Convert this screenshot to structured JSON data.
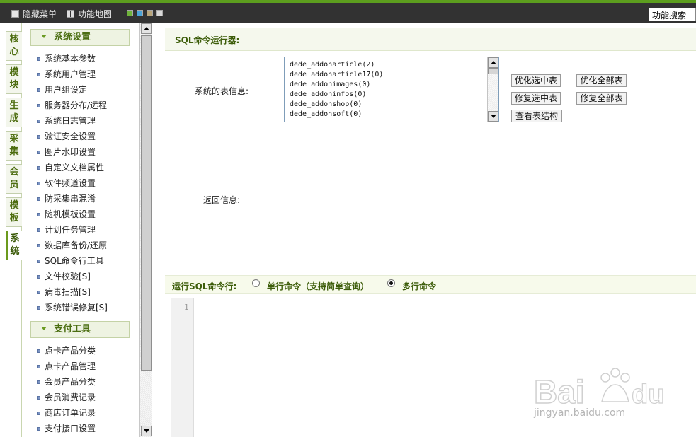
{
  "topbar": {
    "hide_menu": "隐藏菜单",
    "site_map": "功能地图",
    "search": "功能搜索",
    "skins": [
      "#6fb33a",
      "#4aa3d8",
      "#b9a57a",
      "#d8d8d8"
    ]
  },
  "vtabs": [
    "核心",
    "模块",
    "生成",
    "采集",
    "会员",
    "模板",
    "系统"
  ],
  "menu": {
    "sections": [
      {
        "title": "系统设置",
        "items": [
          "系统基本参数",
          "系统用户管理",
          "用户组设定",
          "服务器分布/远程",
          "系统日志管理",
          "验证安全设置",
          "图片水印设置",
          "自定义文档属性",
          "软件频道设置",
          "防采集串混淆",
          "随机模板设置",
          "计划任务管理",
          "数据库备份/还原",
          "SQL命令行工具",
          "文件校验[S]",
          "病毒扫描[S]",
          "系统错误修复[S]"
        ]
      },
      {
        "title": "支付工具",
        "items": [
          "点卡产品分类",
          "点卡产品管理",
          "会员产品分类",
          "会员消费记录",
          "商店订单记录",
          "支付接口设置"
        ]
      }
    ]
  },
  "main": {
    "title": "SQL命令运行器:",
    "table_info_label": "系统的表信息:",
    "tables": [
      "dede_addonarticle(2)",
      "dede_addonarticle17(0)",
      "dede_addonimages(0)",
      "dede_addoninfos(0)",
      "dede_addonshop(0)",
      "dede_addonsoft(0)"
    ],
    "buttons": {
      "optimize_selected": "优化选中表",
      "optimize_all": "优化全部表",
      "repair_selected": "修复选中表",
      "repair_all": "修复全部表",
      "view_structure": "查看表结构"
    },
    "return_label": "返回信息:",
    "sql_label": "运行SQL命令行:",
    "single_mode": "单行命令（支持简单查询）",
    "multi_mode": "多行命令",
    "line_number": "1"
  },
  "watermark": {
    "text": "jingyan.baidu.com"
  }
}
